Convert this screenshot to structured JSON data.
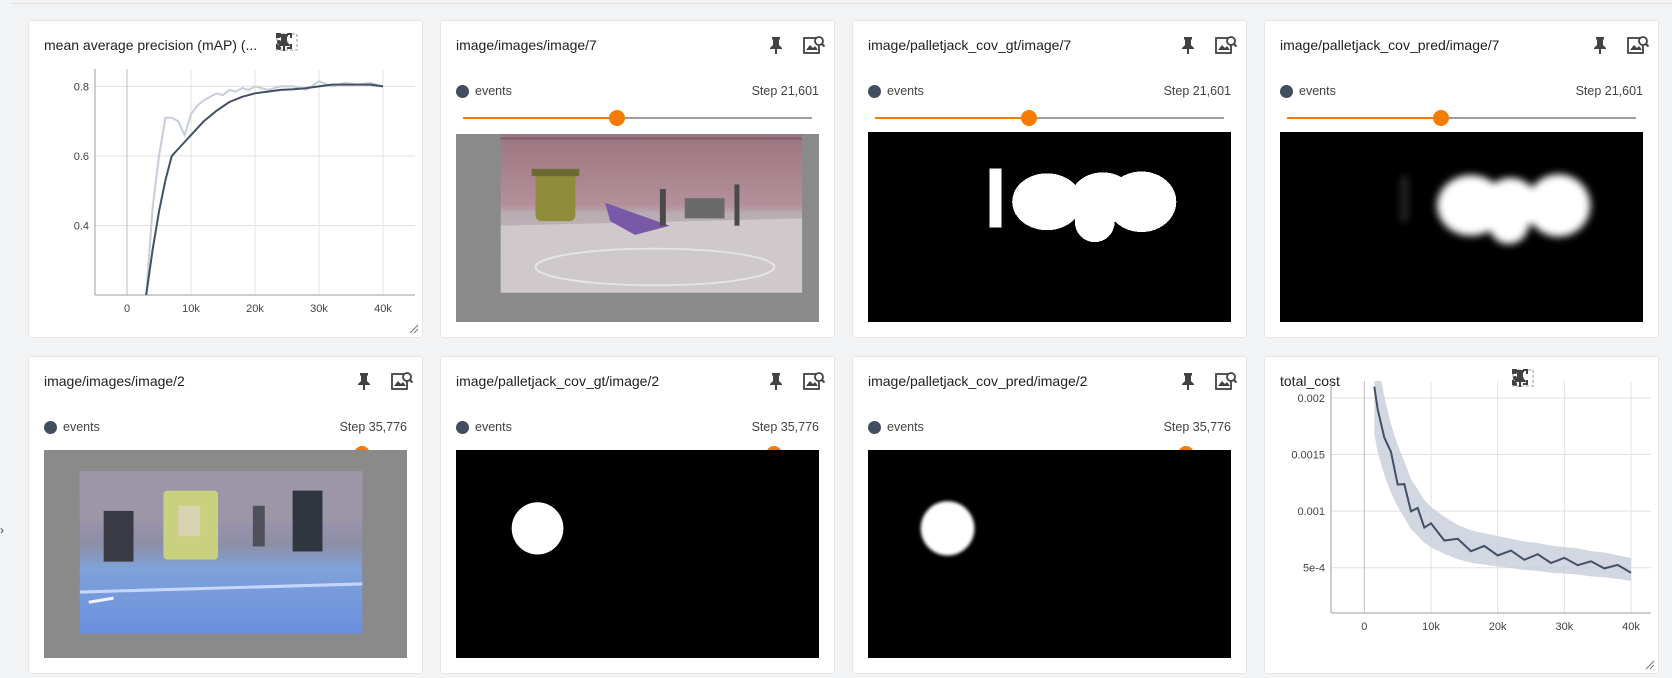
{
  "cards": [
    {
      "id": "map-chart",
      "title": "mean average precision (mAP) (...",
      "icons": [
        "fit-domain-icon",
        "pin-icon",
        "fullscreen-icon",
        "more-vert-icon"
      ]
    },
    {
      "id": "img-7",
      "title": "image/images/image/7",
      "run": "events",
      "step": "Step 21,601",
      "slider_fraction": 0.44,
      "icons": [
        "pin-icon",
        "image-settings-icon"
      ]
    },
    {
      "id": "gt-7",
      "title": "image/palletjack_cov_gt/image/7",
      "run": "events",
      "step": "Step 21,601",
      "slider_fraction": 0.44,
      "icons": [
        "pin-icon",
        "image-settings-icon"
      ]
    },
    {
      "id": "pred-7",
      "title": "image/palletjack_cov_pred/image/7",
      "run": "events",
      "step": "Step 21,601",
      "slider_fraction": 0.44,
      "icons": [
        "pin-icon",
        "image-settings-icon"
      ]
    },
    {
      "id": "img-2",
      "title": "image/images/image/2",
      "run": "events",
      "step": "Step 35,776",
      "slider_fraction": 0.89,
      "icons": [
        "pin-icon",
        "image-settings-icon"
      ]
    },
    {
      "id": "gt-2",
      "title": "image/palletjack_cov_gt/image/2",
      "run": "events",
      "step": "Step 35,776",
      "slider_fraction": 0.89,
      "icons": [
        "pin-icon",
        "image-settings-icon"
      ]
    },
    {
      "id": "pred-2",
      "title": "image/palletjack_cov_pred/image/2",
      "run": "events",
      "step": "Step 35,776",
      "slider_fraction": 0.89,
      "icons": [
        "pin-icon",
        "image-settings-icon"
      ]
    },
    {
      "id": "cost-chart",
      "title": "total_cost",
      "icons": [
        "fit-domain-icon",
        "pin-icon",
        "fullscreen-icon",
        "more-vert-icon"
      ]
    }
  ],
  "colors": {
    "accent": "#f57c00",
    "run": "#424e5f",
    "smoothed_line": "#425066",
    "raw_line": "#c7cdd9"
  },
  "chart_data": [
    {
      "type": "line",
      "title": "mean average precision (mAP) (...",
      "xlabel": "",
      "ylabel": "",
      "xlim": [
        -5000,
        45000
      ],
      "ylim": [
        0.2,
        0.85
      ],
      "x_ticks": [
        "0",
        "10k",
        "20k",
        "30k",
        "40k"
      ],
      "x_tick_values": [
        0,
        10000,
        20000,
        30000,
        40000
      ],
      "y_ticks": [
        "0.4",
        "0.6",
        "0.8"
      ],
      "y_tick_values": [
        0.4,
        0.6,
        0.8
      ],
      "grid": true,
      "series": [
        {
          "role": "raw",
          "x": [
            3000,
            4000,
            5000,
            6000,
            7000,
            8000,
            9000,
            10000,
            11000,
            12000,
            13000,
            14000,
            15000,
            16000,
            17000,
            18000,
            19000,
            20000,
            22000,
            24000,
            26000,
            28000,
            30000,
            32000,
            34000,
            36000,
            38000,
            40000
          ],
          "y": [
            0.2,
            0.45,
            0.6,
            0.71,
            0.71,
            0.7,
            0.66,
            0.72,
            0.745,
            0.76,
            0.77,
            0.78,
            0.775,
            0.79,
            0.785,
            0.795,
            0.79,
            0.8,
            0.79,
            0.8,
            0.8,
            0.79,
            0.815,
            0.8,
            0.81,
            0.805,
            0.81,
            0.8
          ]
        },
        {
          "role": "smoothed",
          "x": [
            3000,
            4000,
            5000,
            6000,
            7000,
            8000,
            9000,
            10000,
            12000,
            14000,
            16000,
            18000,
            20000,
            22000,
            24000,
            26000,
            28000,
            30000,
            32000,
            34000,
            36000,
            38000,
            40000
          ],
          "y": [
            0.2,
            0.33,
            0.44,
            0.53,
            0.6,
            0.62,
            0.64,
            0.66,
            0.7,
            0.73,
            0.755,
            0.77,
            0.78,
            0.785,
            0.79,
            0.792,
            0.795,
            0.8,
            0.805,
            0.805,
            0.805,
            0.805,
            0.8
          ]
        }
      ]
    },
    {
      "type": "line",
      "title": "total_cost",
      "xlabel": "",
      "ylabel": "",
      "xlim": [
        -5000,
        43000
      ],
      "ylim": [
        0.0001,
        0.00215
      ],
      "x_ticks": [
        "0",
        "10k",
        "20k",
        "30k",
        "40k"
      ],
      "x_tick_values": [
        0,
        10000,
        20000,
        30000,
        40000
      ],
      "y_ticks": [
        "5e-4",
        "0.001",
        "0.0015",
        "0.002"
      ],
      "y_tick_values": [
        0.0005,
        0.001,
        0.0015,
        0.002
      ],
      "grid": true,
      "series": [
        {
          "role": "smoothed",
          "x": [
            1500,
            2000,
            3000,
            4000,
            5000,
            6000,
            7000,
            8000,
            9000,
            10000,
            12000,
            14000,
            16000,
            18000,
            20000,
            22000,
            24000,
            26000,
            28000,
            30000,
            32000,
            34000,
            36000,
            38000,
            40000
          ],
          "y": [
            0.0021,
            0.0019,
            0.00165,
            0.00145,
            0.0013,
            0.00118,
            0.00105,
            0.00098,
            0.0009,
            0.00085,
            0.00078,
            0.00072,
            0.00068,
            0.00066,
            0.00064,
            0.00062,
            0.0006,
            0.00059,
            0.00057,
            0.00056,
            0.00055,
            0.00053,
            0.00052,
            0.0005,
            0.00048
          ]
        }
      ]
    }
  ]
}
